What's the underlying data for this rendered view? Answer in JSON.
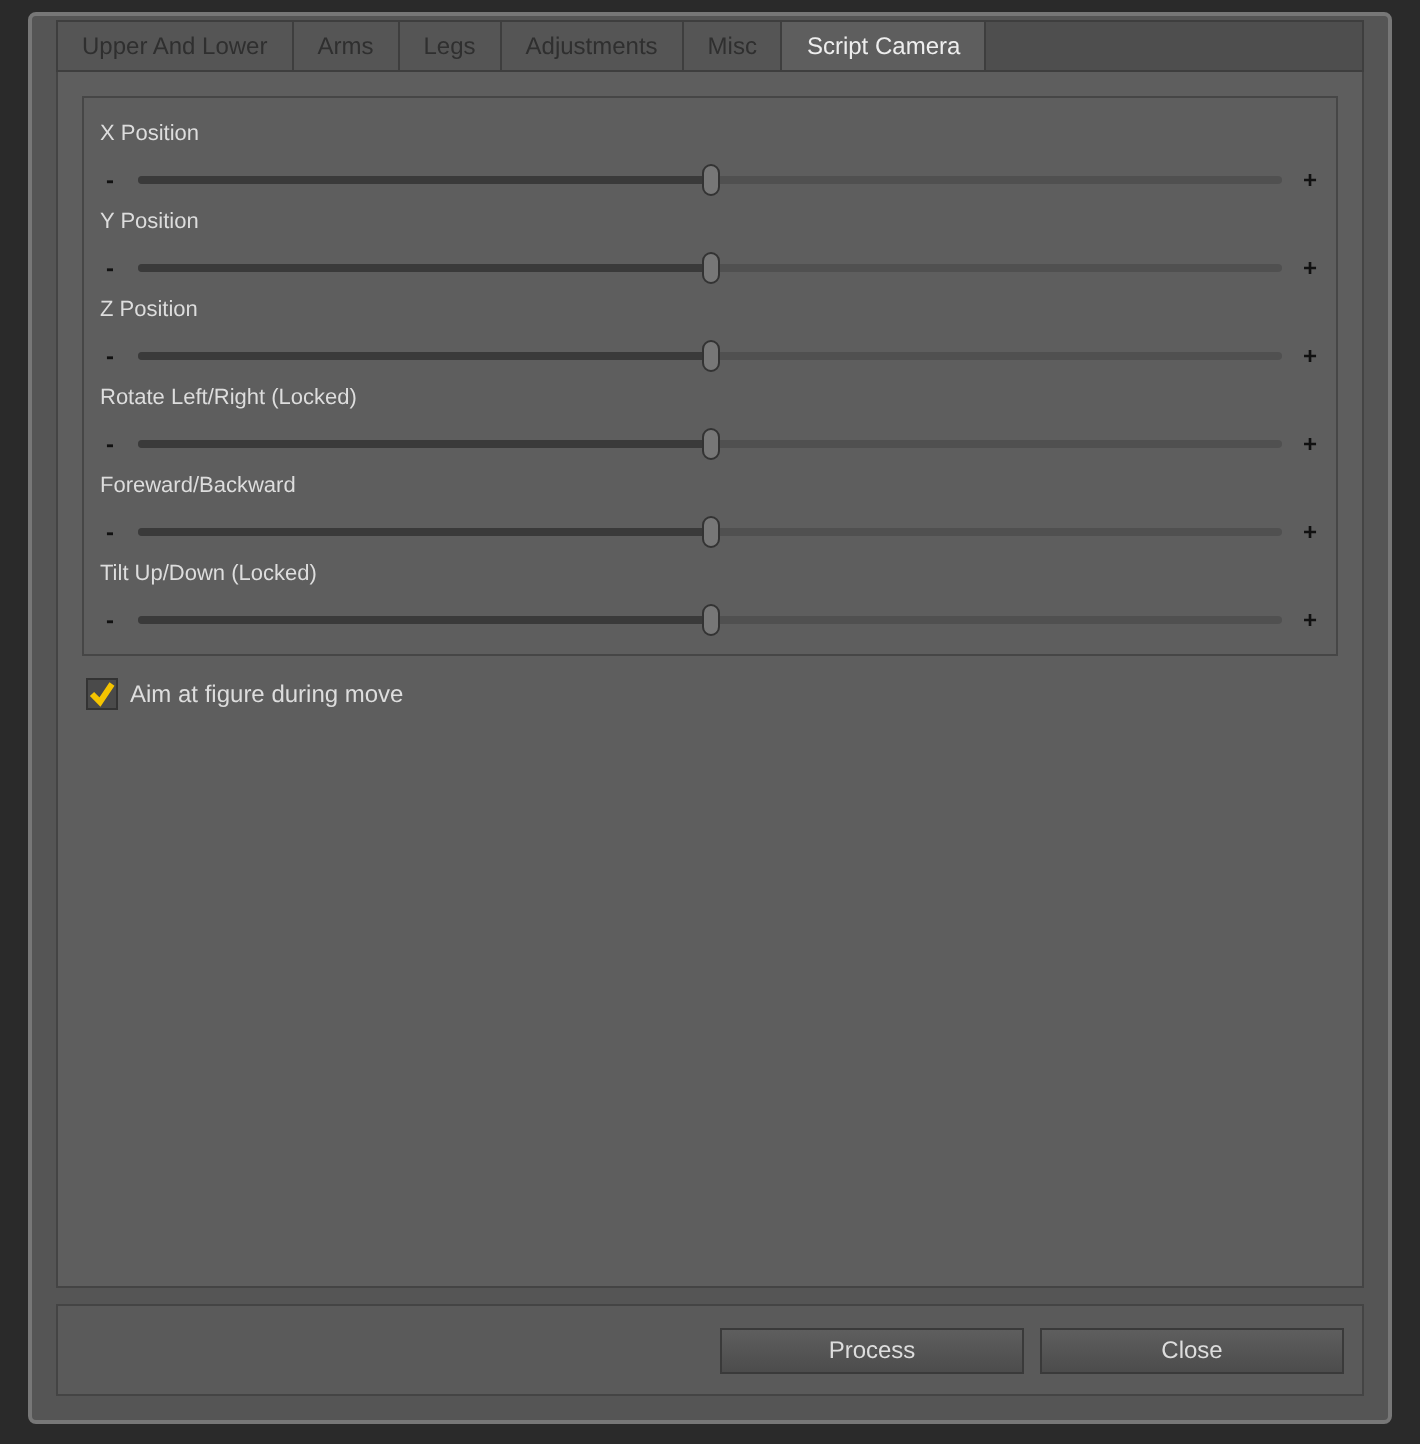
{
  "tabs": [
    {
      "label": "Upper And Lower",
      "selected": false
    },
    {
      "label": "Arms",
      "selected": false
    },
    {
      "label": "Legs",
      "selected": false
    },
    {
      "label": "Adjustments",
      "selected": false
    },
    {
      "label": "Misc",
      "selected": false
    },
    {
      "label": "Script Camera",
      "selected": true
    }
  ],
  "sliders": [
    {
      "label": "X Position",
      "minus": "-",
      "plus": "+",
      "level": 0.5
    },
    {
      "label": "Y Position",
      "minus": "-",
      "plus": "+",
      "level": 0.5
    },
    {
      "label": "Z Position",
      "minus": "-",
      "plus": "+",
      "level": 0.5
    },
    {
      "label": "Rotate Left/Right (Locked)",
      "minus": "-",
      "plus": "+",
      "level": 0.5
    },
    {
      "label": "Foreward/Backward",
      "minus": "-",
      "plus": "+",
      "level": 0.5
    },
    {
      "label": "Tilt Up/Down (Locked)",
      "minus": "-",
      "plus": "+",
      "level": 0.5
    }
  ],
  "checkbox": {
    "label": "Aim at figure during move",
    "checked": true
  },
  "buttons": [
    "Process",
    "Close"
  ]
}
